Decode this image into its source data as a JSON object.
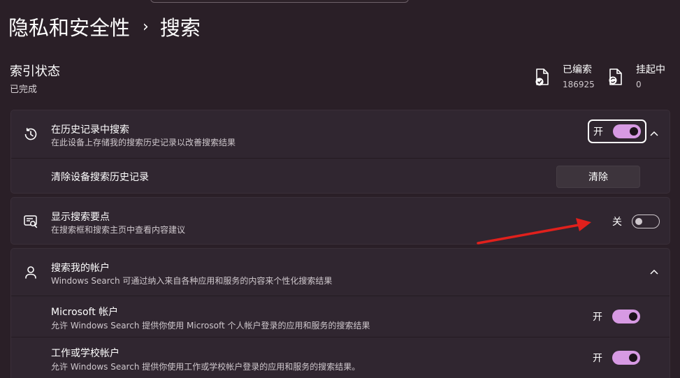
{
  "breadcrumb": {
    "parent": "隐私和安全性",
    "current": "搜索"
  },
  "index_status": {
    "title": "索引状态",
    "status": "已完成",
    "indexed": {
      "label": "已编索",
      "value": "186925",
      "icon": "document-check-icon"
    },
    "pending": {
      "label": "挂起中",
      "value": "0",
      "icon": "document-sync-icon"
    }
  },
  "history": {
    "icon": "history-icon",
    "title": "在历史记录中搜索",
    "description": "在此设备上存储我的搜索历史记录以改善搜索结果",
    "toggle_state": "开",
    "toggle_on": true,
    "clear": {
      "title": "清除设备搜索历史记录",
      "button_label": "清除"
    }
  },
  "highlights": {
    "icon": "search-highlights-icon",
    "title": "显示搜索要点",
    "description": "在搜索框和搜索主页中查看内容建议",
    "toggle_state": "关",
    "toggle_on": false
  },
  "accounts": {
    "icon": "person-icon",
    "title": "搜索我的帐户",
    "description": "Windows Search 可通过纳入来自各种应用和服务的内容来个性化搜索结果",
    "microsoft": {
      "title": "Microsoft 帐户",
      "description": "允许 Windows Search 提供你使用 Microsoft 个人帐户登录的应用和服务的搜索结果",
      "toggle_state": "开",
      "toggle_on": true
    },
    "work": {
      "title": "工作或学校帐户",
      "description": "允许 Windows Search 提供你使用工作或学校帐户登录的应用和服务的搜索结果。",
      "toggle_state": "开",
      "toggle_on": true
    }
  },
  "colors": {
    "accent": "#d79ae3",
    "background": "#2a1f27",
    "card": "#302630",
    "annotation_arrow": "#e0201c"
  }
}
